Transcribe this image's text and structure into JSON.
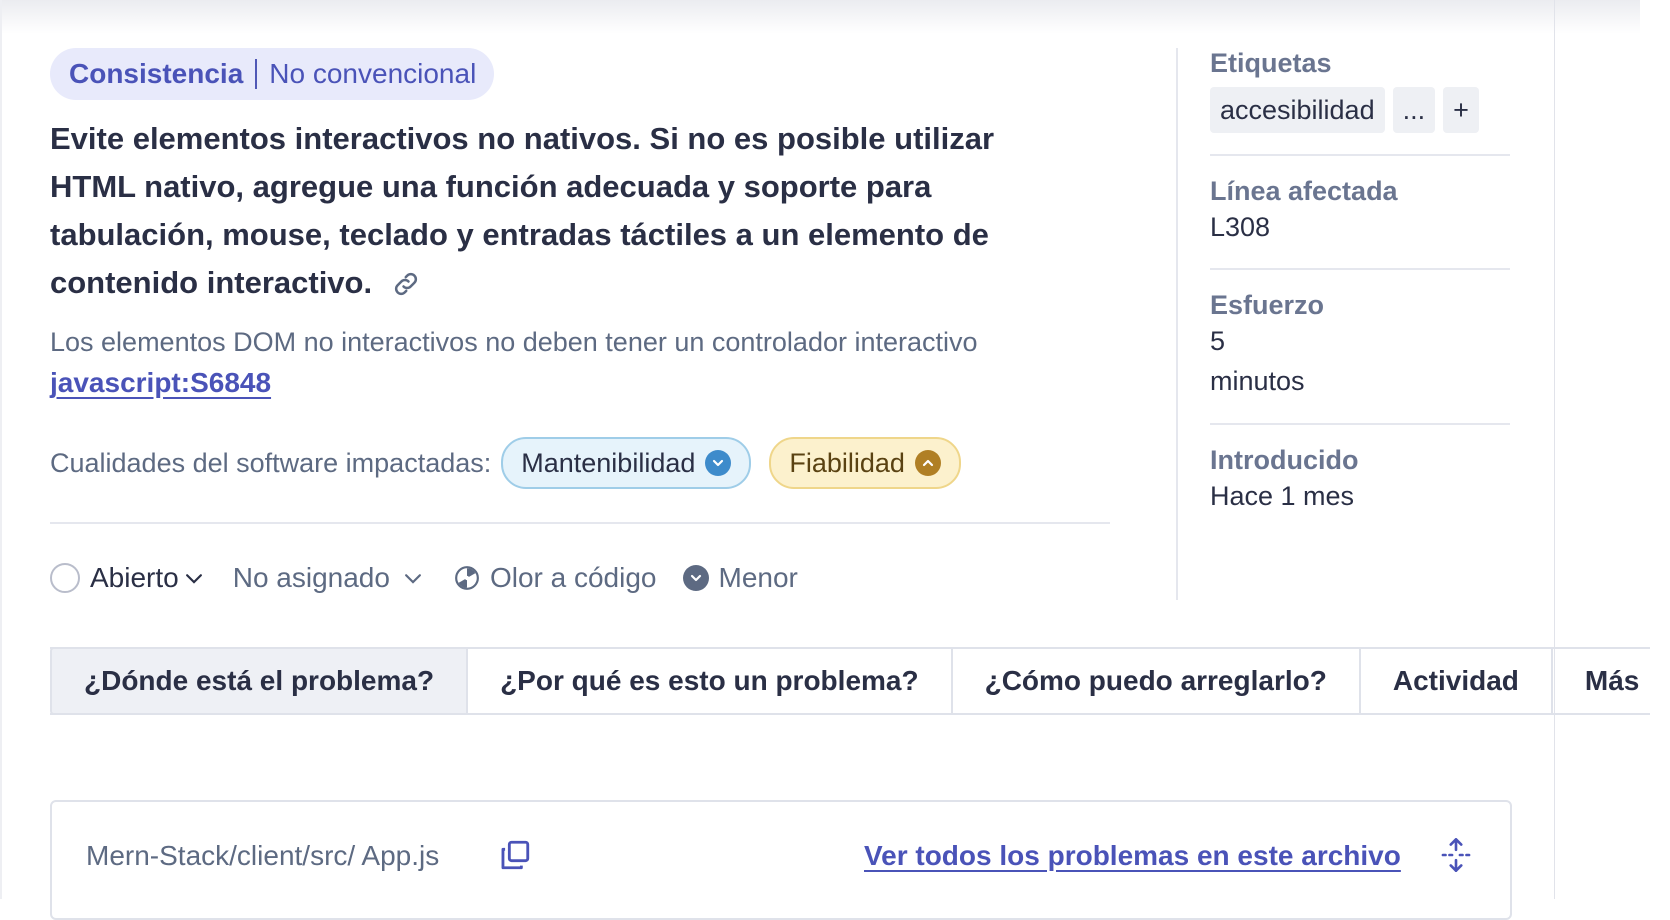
{
  "issue": {
    "attribute": "Consistencia",
    "category": "No convencional",
    "title": "Evite elementos interactivos no nativos. Si no es posible utilizar HTML nativo, agregue una función adecuada y soporte para tabulación, mouse, teclado y entradas táctiles a un elemento de contenido interactivo.",
    "description": "Los elementos DOM no interactivos no deben tener un controlador interactivo",
    "rule_key": "javascript:S6848",
    "qualities_label": "Cualidades del software impactadas:",
    "qualities": [
      {
        "label": "Mantenibilidad",
        "severity_icon": "chevron-down-icon",
        "color": "#3e8bcb"
      },
      {
        "label": "Fiabilidad",
        "severity_icon": "chevron-up-icon",
        "color": "#b07f24"
      }
    ]
  },
  "status_row": {
    "status": "Abierto",
    "assignee": "No asignado",
    "type": "Olor a código",
    "severity": "Menor"
  },
  "meta": {
    "tags_label": "Etiquetas",
    "tags": [
      "accesibilidad",
      "...",
      "+"
    ],
    "line_label": "Línea afectada",
    "line_value": "L308",
    "effort_label": "Esfuerzo",
    "effort_value": "5",
    "effort_unit": "minutos",
    "introduced_label": "Introducido",
    "introduced_value": "Hace 1 mes"
  },
  "tabs": [
    {
      "label": "¿Dónde está el problema?",
      "active": true
    },
    {
      "label": "¿Por qué es esto un problema?",
      "active": false
    },
    {
      "label": "¿Cómo puedo arreglarlo?",
      "active": false
    },
    {
      "label": "Actividad",
      "active": false
    },
    {
      "label": "Más",
      "active": false
    }
  ],
  "file": {
    "path": "Mern-Stack/client/src/ App.js",
    "link_label": "Ver todos los problemas en este archivo"
  }
}
